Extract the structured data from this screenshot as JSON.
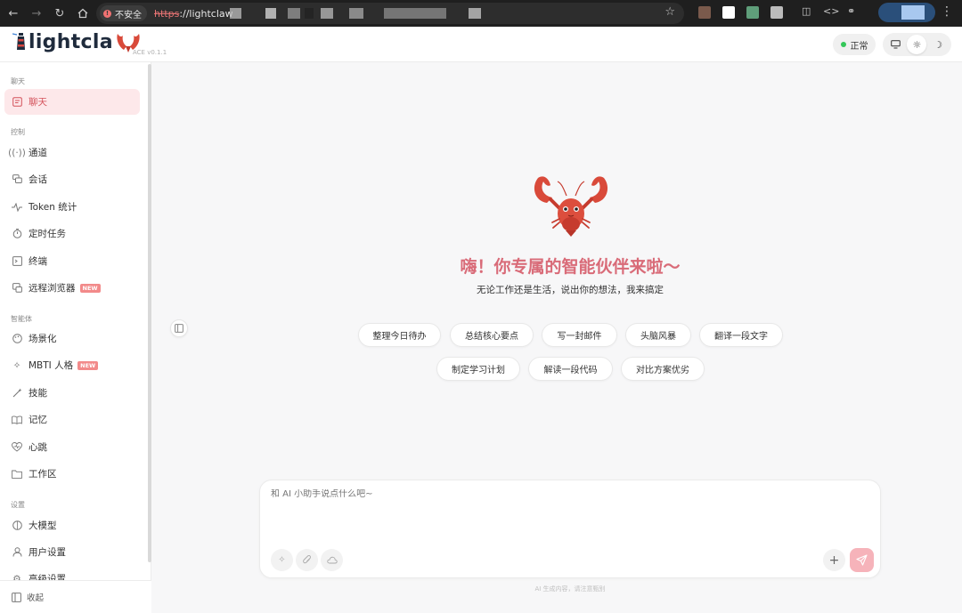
{
  "browser": {
    "insecure_label": "不安全",
    "url_protocol": "https",
    "url_rest": "://lightclaw"
  },
  "header": {
    "logo_text": "lightcla",
    "version": "ACE v0.1.1",
    "status": "正常",
    "status_color": "#34c759"
  },
  "sidebar": {
    "sections": [
      {
        "label": "聊天"
      },
      {
        "label": "控制"
      },
      {
        "label": "智能体"
      },
      {
        "label": "设置"
      }
    ],
    "items": [
      {
        "label": "聊天",
        "icon": "chat-icon",
        "active": true
      },
      {
        "label": "通道",
        "icon": "broadcast-icon"
      },
      {
        "label": "会话",
        "icon": "conversation-icon"
      },
      {
        "label": "Token 统计",
        "icon": "activity-icon"
      },
      {
        "label": "定时任务",
        "icon": "timer-icon"
      },
      {
        "label": "终端",
        "icon": "terminal-icon"
      },
      {
        "label": "远程浏览器",
        "icon": "browser-icon",
        "badge": "NEW"
      },
      {
        "label": "场景化",
        "icon": "palette-icon"
      },
      {
        "label": "MBTI 人格",
        "icon": "sparkle-icon",
        "badge": "NEW"
      },
      {
        "label": "技能",
        "icon": "wand-icon"
      },
      {
        "label": "记忆",
        "icon": "book-icon"
      },
      {
        "label": "心跳",
        "icon": "heartbeat-icon"
      },
      {
        "label": "工作区",
        "icon": "folder-icon"
      },
      {
        "label": "大模型",
        "icon": "brain-icon"
      },
      {
        "label": "用户设置",
        "icon": "user-icon"
      },
      {
        "label": "高级设置",
        "icon": "gear-icon"
      }
    ],
    "collapse_label": "收起"
  },
  "hero": {
    "title": "嗨！你专属的智能伙伴来啦～",
    "subtitle": "无论工作还是生活，说出你的想法，我来搞定"
  },
  "suggestions": [
    "整理今日待办",
    "总结核心要点",
    "写一封邮件",
    "头脑风暴",
    "翻译一段文字",
    "制定学习计划",
    "解读一段代码",
    "对比方案优劣"
  ],
  "composer": {
    "placeholder": "和 AI 小助手说点什么吧~"
  },
  "footnote": "AI 生成内容，请注意甄别",
  "colors": {
    "accent": "#d96b78",
    "active_bg": "#fde8ea",
    "send": "#f6b3ba"
  }
}
